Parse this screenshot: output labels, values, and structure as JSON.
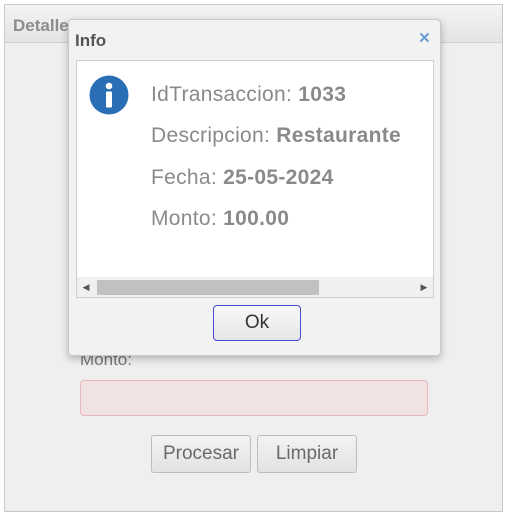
{
  "background": {
    "panel_title": "Detalle",
    "monto_label": "Monto:",
    "procesar_label": "Procesar",
    "limpiar_label": "Limpiar"
  },
  "dialog": {
    "title": "Info",
    "close_glyph": "×",
    "icon": "info-icon",
    "fields": [
      {
        "label": "IdTransaccion:",
        "value": "1033"
      },
      {
        "label": "Descripcion:",
        "value": "Restaurante"
      },
      {
        "label": "Fecha:",
        "value": "25-05-2024"
      },
      {
        "label": "Monto:",
        "value": "100.00"
      }
    ],
    "ok_label": "Ok"
  },
  "colors": {
    "accent": "#2a6fb5",
    "close": "#6a9fd3",
    "input_error_bg": "#f1e3e3"
  }
}
